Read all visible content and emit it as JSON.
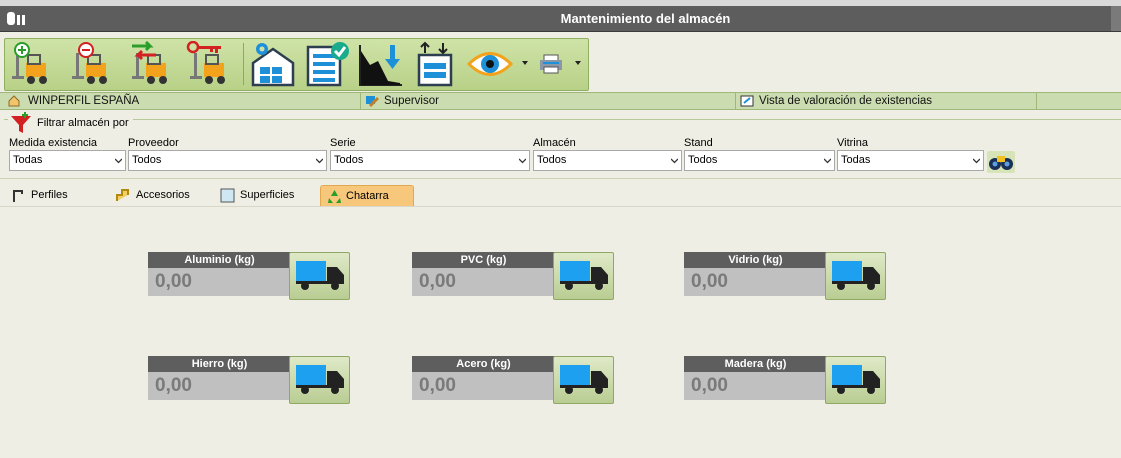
{
  "window": {
    "title": "Mantenimiento del almacén"
  },
  "toolbar": {
    "buttons": [
      {
        "name": "forklift-add-icon"
      },
      {
        "name": "forklift-remove-icon"
      },
      {
        "name": "forklift-transfer-icon"
      },
      {
        "name": "forklift-key-icon"
      },
      {
        "name": "warehouse-settings-icon"
      },
      {
        "name": "checklist-icon"
      },
      {
        "name": "chart-download-icon"
      },
      {
        "name": "stock-updown-icon"
      },
      {
        "name": "eye-view-icon"
      },
      {
        "name": "printer-icon"
      }
    ],
    "colors": {
      "accent": "#b8d187",
      "border": "#8fb060"
    }
  },
  "statusbar": {
    "company": "WINPERFIL ESPAÑA",
    "user": "Supervisor",
    "view": "Vista de valoración de existencias"
  },
  "filters": {
    "legend": "Filtrar almacén por",
    "fields": [
      {
        "label": "Medida existencia",
        "value": "Todas"
      },
      {
        "label": "Proveedor",
        "value": "Todos"
      },
      {
        "label": "Serie",
        "value": "Todos"
      },
      {
        "label": "Almacén",
        "value": "Todos"
      },
      {
        "label": "Stand",
        "value": "Todos"
      },
      {
        "label": "Vitrina",
        "value": "Todas"
      }
    ]
  },
  "tabs": [
    {
      "label": "Perfiles",
      "active": false
    },
    {
      "label": "Accesorios",
      "active": false
    },
    {
      "label": "Superficies",
      "active": false
    },
    {
      "label": "Chatarra",
      "active": true
    }
  ],
  "scrap": {
    "cards": [
      {
        "label": "Aluminio (kg)",
        "value": "0,00"
      },
      {
        "label": "PVC (kg)",
        "value": "0,00"
      },
      {
        "label": "Vidrio (kg)",
        "value": "0,00"
      },
      {
        "label": "Hierro (kg)",
        "value": "0,00"
      },
      {
        "label": "Acero (kg)",
        "value": "0,00"
      },
      {
        "label": "Madera (kg)",
        "value": "0,00"
      }
    ],
    "colors": {
      "header": "#5e5e5e",
      "value_bg": "#c0c0c0",
      "truck": "#1ea0f0"
    }
  }
}
